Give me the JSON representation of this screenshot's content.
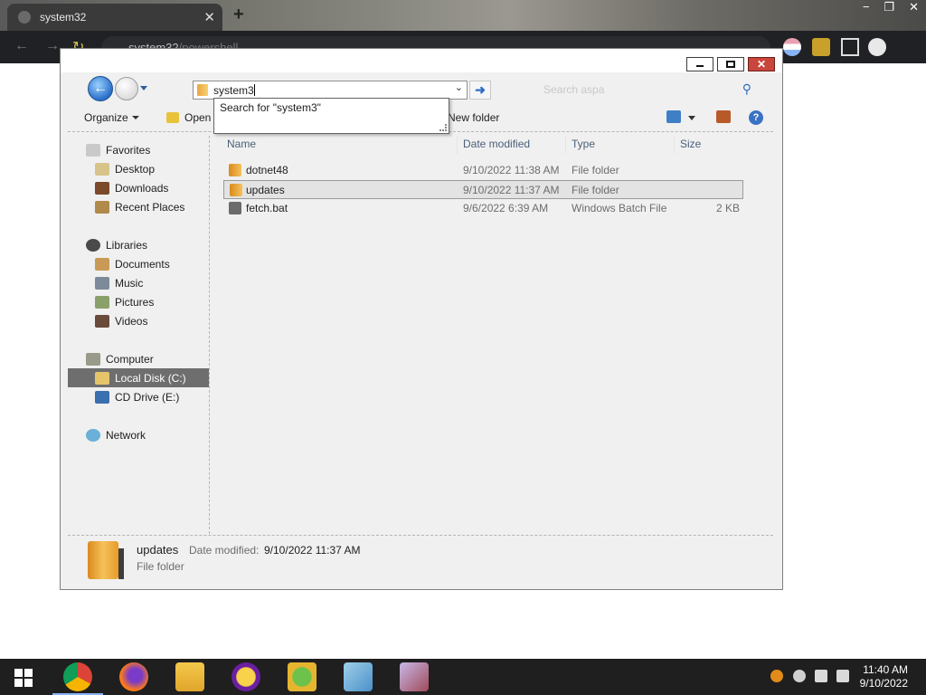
{
  "browser": {
    "tab_title": "system32",
    "tab_close": "✕",
    "new_tab": "+",
    "address": "system32",
    "address_suffix": "/powershell",
    "win_controls": [
      "−",
      "❐",
      "✕"
    ]
  },
  "explorer": {
    "title_buttons": {
      "close": "✕"
    },
    "address_value": "system3",
    "search_placeholder": "Search aspa",
    "autocomplete": "Search for \"system3\"",
    "toolbar": {
      "organize": "Organize",
      "open": "Open",
      "new_folder": "New folder"
    },
    "nav": {
      "favorites": "Favorites",
      "desktop": "Desktop",
      "downloads": "Downloads",
      "recent": "Recent Places",
      "libraries": "Libraries",
      "documents": "Documents",
      "music": "Music",
      "pictures": "Pictures",
      "videos": "Videos",
      "computer": "Computer",
      "local_disk": "Local Disk (C:)",
      "cd_drive": "CD Drive (E:)",
      "network": "Network"
    },
    "columns": [
      "Name",
      "Date modified",
      "Type",
      "Size"
    ],
    "files": [
      {
        "name": "dotnet48",
        "date": "9/10/2022 11:38 AM",
        "type": "File folder",
        "size": ""
      },
      {
        "name": "updates",
        "date": "9/10/2022 11:37 AM",
        "type": "File folder",
        "size": ""
      },
      {
        "name": "fetch.bat",
        "date": "9/6/2022 6:39 AM",
        "type": "Windows Batch File",
        "size": "2 KB"
      }
    ],
    "details": {
      "name": "updates",
      "date_label": "Date modified:",
      "date_value": "9/10/2022 11:37 AM",
      "type": "File folder"
    }
  },
  "taskbar": {
    "time": "11:40 AM",
    "date": "9/10/2022"
  },
  "colors": {
    "selected_nav": "#6e6e6e",
    "header_text": "#4c607a",
    "taskbar": "#1f1f1f"
  }
}
